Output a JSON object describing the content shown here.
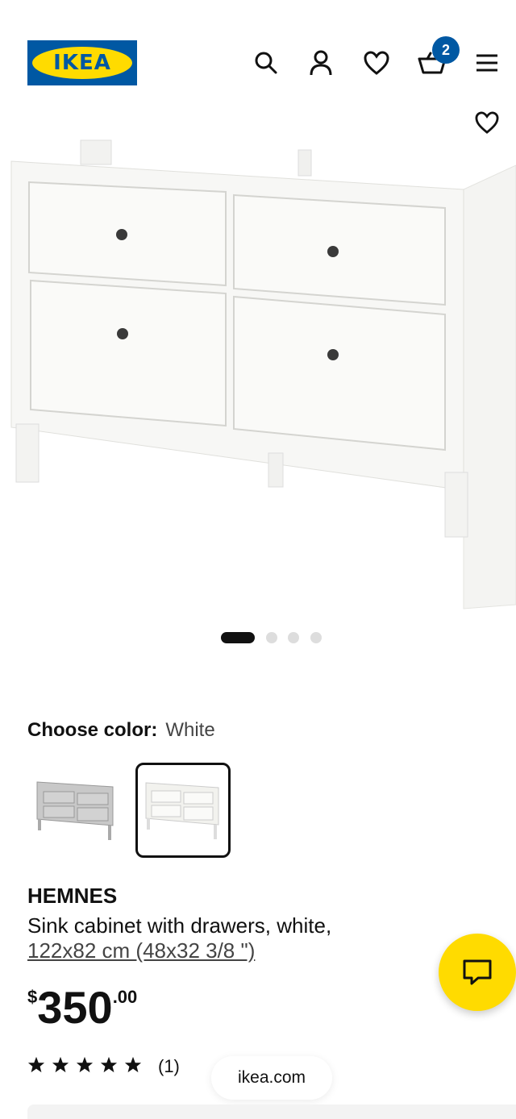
{
  "header": {
    "logo_text": "IKEA",
    "icons": [
      "search-icon",
      "account-icon",
      "favorites-icon",
      "cart-icon",
      "menu-icon"
    ],
    "cart_count": "2"
  },
  "gallery": {
    "image_alt": "HEMNES sink cabinet with drawers, white",
    "dots_total": 4,
    "active_dot": 1
  },
  "color": {
    "label": "Choose color:",
    "value": "White",
    "options": [
      "Gray",
      "White"
    ],
    "selected": "White"
  },
  "product": {
    "name": "HEMNES",
    "description": "Sink cabinet with drawers, white,",
    "size": "122x82 cm (48x32 3/8 \")",
    "price_currency": "$",
    "price_int": "350",
    "price_dec": ".00",
    "rating_stars": 5,
    "rating_count": "(1)"
  },
  "browser": {
    "url": "ikea.com"
  },
  "colors": {
    "ikea_blue": "#0058a3",
    "ikea_yellow": "#ffdb00"
  }
}
